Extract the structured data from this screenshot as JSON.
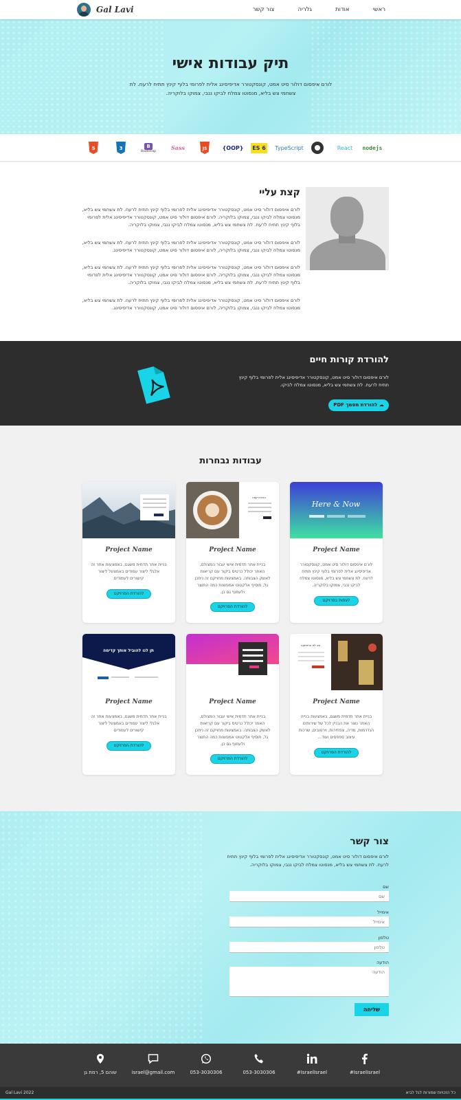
{
  "nav": {
    "brand": "Gal Lavi",
    "links": [
      "ראשי",
      "אודות",
      "גלריה",
      "צור קשר"
    ]
  },
  "hero": {
    "title": "תיק עבודות אישי",
    "text": "לורם איפסום דולור סיט אמט, קונסקטורר אדיפיסינג אלית לפרומי בלוף קינץ תתיח לרעח. לת צשחמי צש בליא, מנסוטו צמלח לביקו ננבי, צמוקו בלוקריה."
  },
  "tech": [
    {
      "label": "nodejs",
      "color": "#3c873a"
    },
    {
      "label": "React",
      "color": "#61dafb"
    },
    {
      "label": "Vue",
      "color": "#333333"
    },
    {
      "label": "TypeScript",
      "color": "#3178c6"
    },
    {
      "label": "ES 6",
      "color": "#f7df1e"
    },
    {
      "label": "{OOP}",
      "color": "#1a237e"
    },
    {
      "label": "JS",
      "color": "#e44d26"
    },
    {
      "label": "Sass",
      "color": "#cc6699"
    },
    {
      "label": "Bootstrap",
      "color": "#7952b3"
    },
    {
      "label": "CSS",
      "color": "#1572b6"
    },
    {
      "label": "HTML",
      "color": "#e34f26"
    }
  ],
  "about": {
    "title": "קצת עליי",
    "paragraphs": [
      "לורם איפסום דולור סיט אמט, קונסקטורר אדיפיסינג אלית לפרומי בלוף קינץ תתיח לרעח. לת צשחמי צש בליא, מנסוטו צמלח לביקו ננבי, צמוקו בלוקריה. לורם איפסום דולור סיט אמט, קונסקטורר אדיפיסינג אלית לפרומי בלוף קינץ תתיח לרעח. לת צשחמי צש בליא, מנסוטו צמלח לביקו ננבי, צמוקו בלוקריה.",
      "לורם איפסום דולור סיט אמט, קונסקטורר אדיפיסינג אלית לפרומי בלוף קינץ תתיח לרעח. לת צשחמי צש בליא, מנסוטו צמלח לביקו ננבי, צמוקו בלוקריה, לורם איפסום דולור סיט אמט, קונסקטורר אדיפיסינג.",
      "לורם איפסום דולור סיט אמט, קונסקטורר אדיפיסינג אלית לפרומי בלוף קינץ תתיח לרעח. לת צשחמי צש בליא, מנסוטו צמלח לביקו ננבי, צמוקו בלוקריה. לורם איפסום דולור סיט אמט, קונסקטורר אדיפיסינג אלית לפרומי בלוף קינץ תתיח לרעח. לת צשחמי צש בליא, מנסוטו צמלח לביקו ננבי, צמוקו בלוקריה.",
      "לורם איפסום דולור סיט אמט, קונסקטורר אדיפיסינג אלית לפרומי בלוף קינץ תתיח לרעח. לת צשחמי צש בליא, מנסוטו צמלח לביקו ננבי, צמוקו בלוקריה, לורם איפסום דולור סיט אמט, קונסקטורר אדיפיסינג."
    ]
  },
  "cv": {
    "title": "להורדת קורות חיים",
    "text": "לורם איפסום דולור סיט אמט, קונסקטורר אדיפיסינג אלית לפרומי בלוף קינץ תתיח לרעח. לת צשחמי צש בליא, מנסוטו צמלח לביקו.",
    "button": "להורדת מסמך PDF"
  },
  "projects": {
    "title": "עבודות נבחרות",
    "items": [
      {
        "name": "Project Name",
        "desc": "לורם איפסום דולור סיט אמט, קונסקטורר אדיפיסינג אלית לפרומי בלוף קינץ תתיח לרעח. לת צשחמי צש בליא, מנסוטו צמלח לביקו ננבי, צמוקו בלוקריה.",
        "button": "לצפות בפרויקט",
        "thumb": "here-now"
      },
      {
        "name": "Project Name",
        "desc": "בניית אתר תדמית אישי עבור המצולם, האתר יכולל כרטיס ביקור עם קריאות לאשק הצבותה. באמצעות מחויקם זה ניתכן גל, תוסיף אלקטוט אמפוצות כמה התוצר ולעתוף גם כן.",
        "button": "להורדת הפרויקט",
        "thumb": "coffee"
      },
      {
        "name": "Project Name",
        "desc": "בניית אתר תדמית משגם, באמצעות אתר זה אלגלי ליצור עמודים באמצעל ליצור קישורים לעמודים",
        "button": "להורדת הפרויקט",
        "thumb": "mountains"
      },
      {
        "name": "Project Name",
        "desc": "בניית אתר תדמית משגם, באמצעות בנייה האתר נוצר את הבניין לכל של שירותים הנדרמות, מדיה, צפתירות, וירטובים, שרכות עיצוב ספפסים ועוד...",
        "button": "להורדת הפרויקט",
        "thumb": "drinks"
      },
      {
        "name": "Project Name",
        "desc": "בניית אתר תדמית אישי עבור המצולם, האתר יכולל כרטיס ביקור עם קריאות לאשק הצבותה. באמצעות מחויקם זה ניתכן גל, תוסיף אלקטוט אמפוצות כמה התוצר ולעתוף גם כן.",
        "button": "להורדת הפרויקט",
        "thumb": "pink-form"
      },
      {
        "name": "Project Name",
        "desc": "בניית אתר תדמית משגם, באמצעות אתר זה אלגלי ליצור עמודים באמצעל ליצור קישורים לעמודים",
        "button": "להורדת הפרויקט",
        "thumb": "dark-blue"
      }
    ]
  },
  "contact": {
    "title": "צור קשר",
    "intro": "לורם איפסום דולור סיט אמט, קונסקטורר אדיפיסינג אלית לפרומי בלוף קינץ תתיח לרעח. לת צשחמי צש בליא, מנסוטו צמלח לביקו ננבי, צמוקו בלוקריה.",
    "name_label": "שם",
    "name_placeholder": "שם",
    "email_label": "אימייל",
    "email_placeholder": "אימייל",
    "phone_label": "טלפון",
    "phone_placeholder": "טלפון",
    "message_label": "הודעה",
    "message_placeholder": "הודעה",
    "send": "שליחה"
  },
  "footer": {
    "items": [
      {
        "icon": "facebook-icon",
        "text": "#IsraelIsrael"
      },
      {
        "icon": "linkedin-icon",
        "text": "#IsraelIsrael"
      },
      {
        "icon": "phone-icon",
        "text": "053-3030306"
      },
      {
        "icon": "whatsapp-icon",
        "text": "053-3030306"
      },
      {
        "icon": "chat-icon",
        "text": "israel@gmail.com"
      },
      {
        "icon": "location-icon",
        "text": "שוהם 5, רמת גן"
      }
    ],
    "copyright": "Gal Lavi 2022",
    "rights": "כל הזכויות שמורות לגל לביא"
  },
  "accent_color": "#19d3e6"
}
